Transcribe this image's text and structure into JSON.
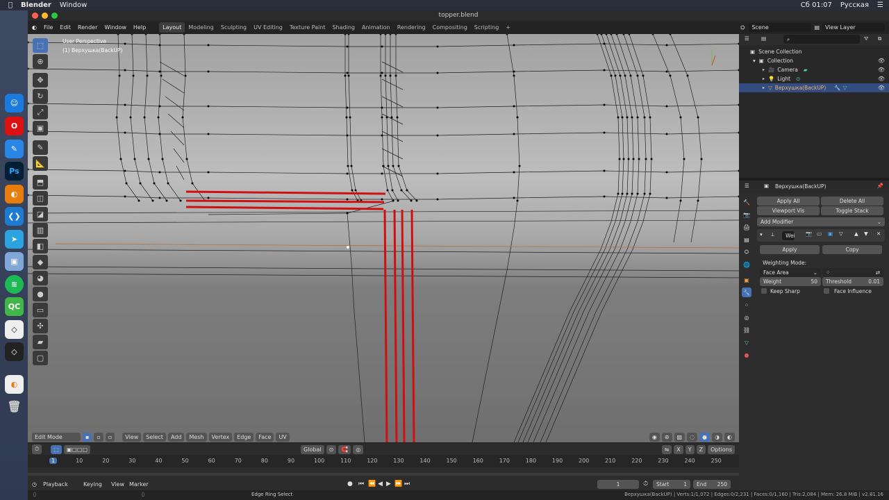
{
  "mac": {
    "app": "Blender",
    "menu_window": "Window",
    "clock": "Сб 01:07",
    "lang": "Русская"
  },
  "window_title": "topper.blend",
  "menu": [
    "File",
    "Edit",
    "Render",
    "Window",
    "Help"
  ],
  "workspaces": [
    "Layout",
    "Modeling",
    "Sculpting",
    "UV Editing",
    "Texture Paint",
    "Shading",
    "Animation",
    "Rendering",
    "Compositing",
    "Scripting"
  ],
  "active_workspace": "Layout",
  "scene_label": "Scene",
  "view_layer_label": "View Layer",
  "viewport": {
    "perspective": "User Perspective",
    "object": "(1) Верхушка(BackUP)"
  },
  "viewport_header": {
    "mode": "Edit Mode",
    "menus": [
      "View",
      "Select",
      "Add",
      "Mesh",
      "Vertex",
      "Edge",
      "Face",
      "UV"
    ],
    "transform": "Global",
    "options": "Options",
    "axes": [
      "X",
      "Y",
      "Z"
    ]
  },
  "timeline": {
    "ticks": [
      "1",
      "10",
      "20",
      "30",
      "40",
      "50",
      "60",
      "70",
      "80",
      "90",
      "100",
      "110",
      "120",
      "130",
      "140",
      "150",
      "160",
      "170",
      "180",
      "190",
      "200",
      "210",
      "220",
      "230",
      "240",
      "250"
    ],
    "menus": [
      "Playback",
      "Keying",
      "View",
      "Marker"
    ],
    "current_frame": "1",
    "start_label": "Start",
    "start": "1",
    "end_label": "End",
    "end": "250"
  },
  "status": {
    "action": "Edge Ring Select",
    "stats": "Верхушка(BackUP) | Verts:1/1,072 | Edges:0/2,231 | Faces:0/1,160 | Tris:2,084 | Mem: 26.8 MiB | v2.81.16"
  },
  "outliner": {
    "root": "Scene Collection",
    "collection": "Collection",
    "items": [
      "Camera",
      "Light",
      "Верхушка(BackUP)"
    ]
  },
  "properties": {
    "object_name": "Верхушка(BackUP)",
    "apply_all": "Apply All",
    "delete_all": "Delete All",
    "viewport_vis": "Viewport Vis",
    "toggle_stack": "Toggle Stack",
    "add_modifier": "Add Modifier",
    "modifier_name": "Wei",
    "apply": "Apply",
    "copy": "Copy",
    "weighting_mode_label": "Weighting Mode:",
    "weighting_mode": "Face Area",
    "weight_label": "Weight",
    "weight": "50",
    "threshold_label": "Threshold",
    "threshold": "0.01",
    "keep_sharp": "Keep Sharp",
    "face_influence": "Face Influence"
  },
  "colors": {
    "accent": "#4772b3",
    "annotation": "#d01010",
    "selected_row": "#334d80",
    "viewport": "#8e8e8e"
  }
}
